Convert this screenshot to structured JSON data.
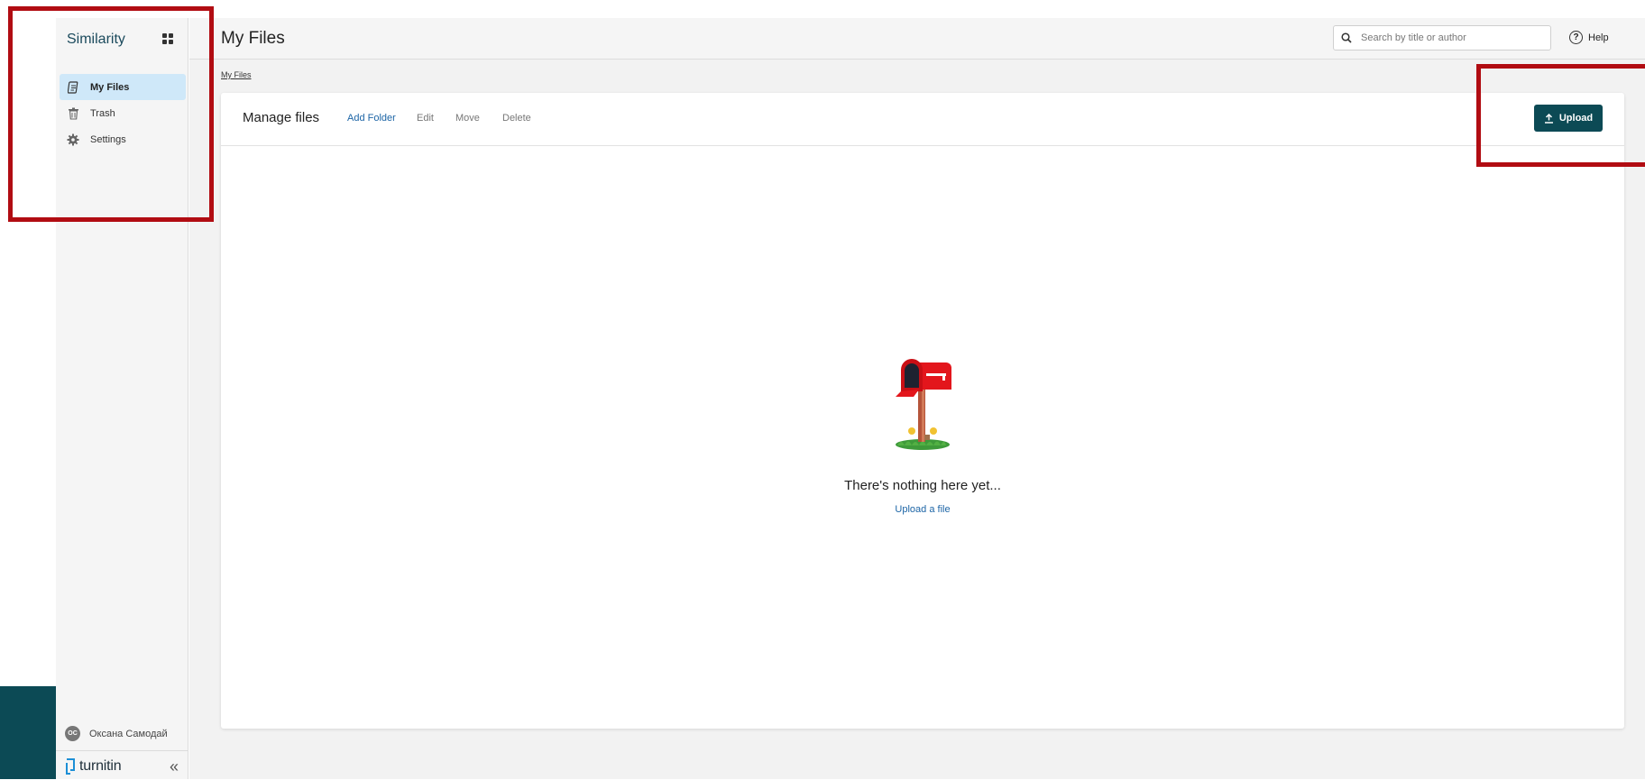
{
  "sidebar": {
    "brand": "Similarity",
    "apps_icon": "grid-icon",
    "items": [
      {
        "label": "My Files",
        "icon": "document-icon",
        "active": true
      },
      {
        "label": "Trash",
        "icon": "trash-icon",
        "active": false
      },
      {
        "label": "Settings",
        "icon": "gear-icon",
        "active": false
      }
    ],
    "user": {
      "initials": "OC",
      "name": "Оксана Самодай"
    },
    "logo_text": "turnitin",
    "collapse_glyph": "«"
  },
  "header": {
    "title": "My Files",
    "search_placeholder": "Search by title or author",
    "help_label": "Help"
  },
  "breadcrumb": "My Files",
  "toolbar": {
    "title": "Manage files",
    "add_folder": "Add Folder",
    "edit": "Edit",
    "move": "Move",
    "delete": "Delete",
    "upload": "Upload"
  },
  "empty_state": {
    "title": "There's nothing here yet...",
    "link": "Upload a file"
  },
  "colors": {
    "accent": "#0c4a55",
    "link": "#1d65a6",
    "active_nav": "#cfe8f9",
    "highlight_box": "#b10c12"
  }
}
